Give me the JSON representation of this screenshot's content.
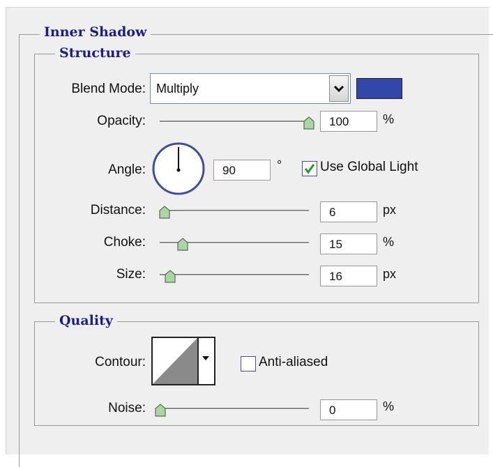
{
  "inner_shadow": {
    "title": "Inner Shadow",
    "structure": {
      "title": "Structure",
      "blend_mode_label": "Blend Mode:",
      "blend_mode_value": "Multiply",
      "shadow_color": "#3347a8",
      "opacity_label": "Opacity:",
      "opacity_value": "100",
      "opacity_unit": "%",
      "opacity_fraction": 1.0,
      "angle_label": "Angle:",
      "angle_value": "90",
      "angle_unit": "°",
      "use_global_light_label": "Use Global Light",
      "use_global_light_checked": true,
      "distance_label": "Distance:",
      "distance_value": "6",
      "distance_unit": "px",
      "choke_label": "Choke:",
      "choke_value": "15",
      "choke_unit": "%",
      "size_label": "Size:",
      "size_value": "16",
      "size_unit": "px"
    },
    "quality": {
      "title": "Quality",
      "contour_label": "Contour:",
      "anti_aliased_label": "Anti-aliased",
      "anti_aliased_checked": false,
      "noise_label": "Noise:",
      "noise_value": "0",
      "noise_unit": "%"
    }
  }
}
